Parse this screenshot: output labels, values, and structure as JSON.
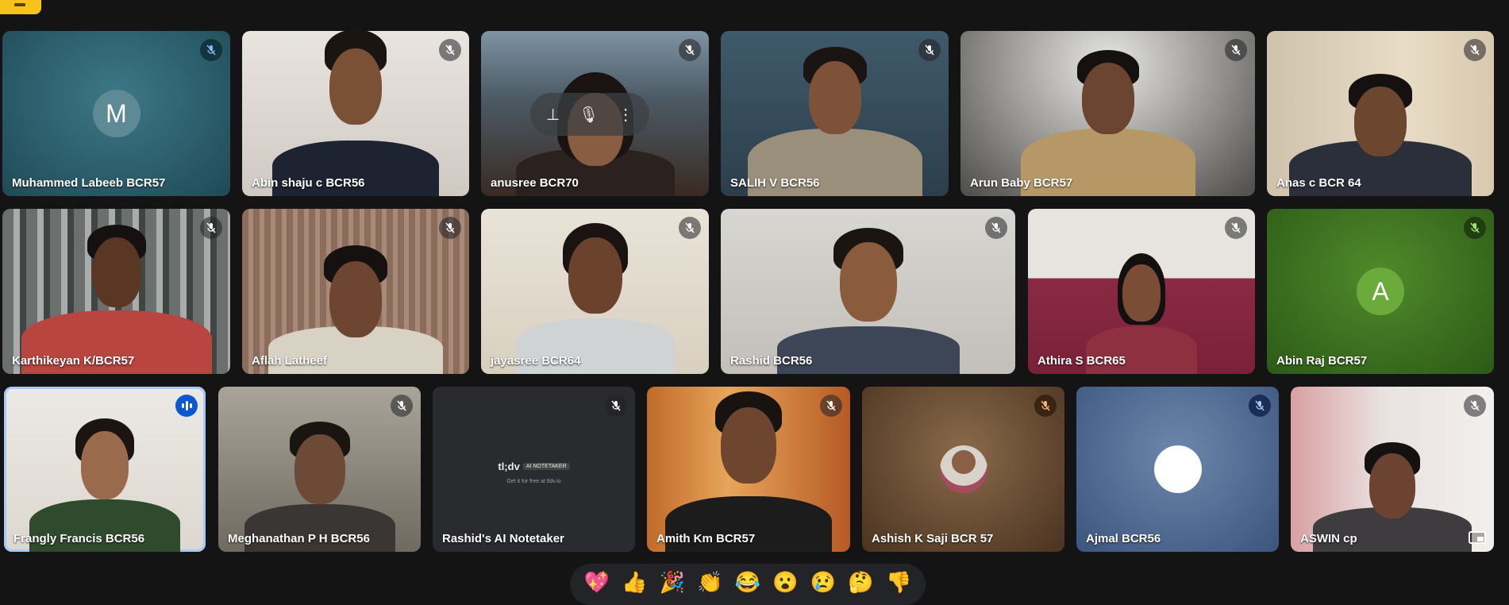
{
  "participants": [
    {
      "name": "Muhammed Labeeb BCR57",
      "avatar_letter": "M",
      "muted": true
    },
    {
      "name": "Abin shaju c BCR56",
      "muted": true
    },
    {
      "name": "anusree BCR70",
      "muted": true
    },
    {
      "name": "SALIH V BCR56",
      "muted": true
    },
    {
      "name": "Arun Baby BCR57",
      "muted": true
    },
    {
      "name": "Anas c BCR 64",
      "muted": true
    },
    {
      "name": "Karthikeyan K/BCR57",
      "muted": true
    },
    {
      "name": "Aflah Latheef",
      "muted": true
    },
    {
      "name": "jayasree BCR64",
      "muted": true
    },
    {
      "name": "Rashid BCR56",
      "muted": true
    },
    {
      "name": "Athira S BCR65",
      "muted": true
    },
    {
      "name": "Abin Raj BCR57",
      "avatar_letter": "A",
      "muted": true
    },
    {
      "name": "Frangly Francis BCR56",
      "speaking": true
    },
    {
      "name": "Meghanathan P H BCR56",
      "muted": true
    },
    {
      "name": "Rashid's AI Notetaker",
      "muted": true
    },
    {
      "name": "Amith Km BCR57",
      "muted": true
    },
    {
      "name": "Ashish K Saji BCR 57",
      "muted": true
    },
    {
      "name": "Ajmal BCR56",
      "muted": true
    },
    {
      "name": "ASWIN cp",
      "muted": true
    }
  ],
  "notetaker": {
    "brand": "tl;dv",
    "tag": "AI NOTETAKER",
    "subtitle": "Get it for free at tldv.io"
  },
  "tile_controls": {
    "pin": "pin-icon",
    "mute": "mic-off-icon",
    "more": "more-vert-icon"
  },
  "reactions": [
    "💖",
    "👍",
    "🎉",
    "👏",
    "😂",
    "😮",
    "😢",
    "🤔",
    "👎"
  ],
  "colors": {
    "background": "#141414",
    "speaking_outline": "#a8c7fa",
    "speaking_indicator": "#0b57d0",
    "corner_chip": "#f6c21b"
  }
}
